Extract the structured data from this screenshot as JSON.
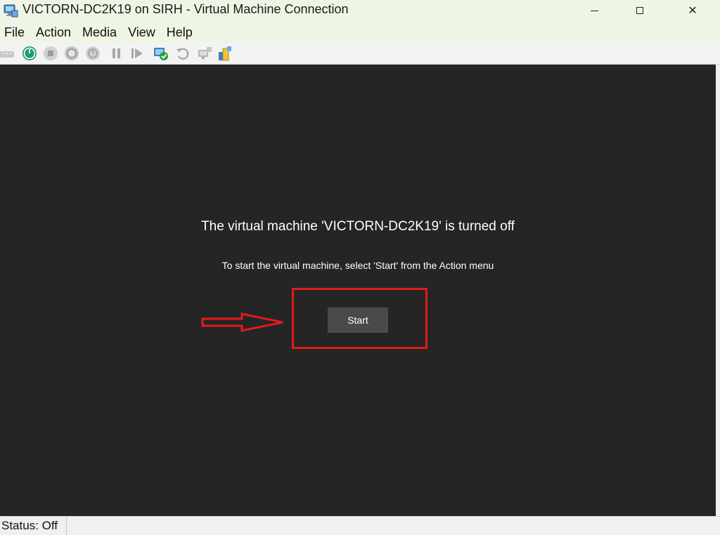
{
  "window": {
    "title": "VICTORN-DC2K19 on SIRH - Virtual Machine Connection",
    "app_icon": "hyper-v-vm-connection-icon",
    "controls": {
      "minimize_icon": "minimize-icon",
      "maximize_icon": "maximize-icon",
      "close_icon": "close-icon",
      "close_glyph": "✕"
    }
  },
  "menu": {
    "items": [
      "File",
      "Action",
      "Media",
      "View",
      "Help"
    ]
  },
  "toolbar": {
    "buttons": [
      {
        "icon": "ctrl-alt-del-icon",
        "enabled": false
      },
      {
        "icon": "start-icon",
        "enabled": true,
        "color": "#1f9d6f"
      },
      {
        "icon": "turn-off-icon",
        "enabled": false
      },
      {
        "icon": "shut-down-icon",
        "enabled": false
      },
      {
        "icon": "save-icon",
        "enabled": false
      },
      {
        "icon": "pause-icon",
        "enabled": false
      },
      {
        "icon": "resume-icon",
        "enabled": false
      },
      {
        "icon": "checkpoint-icon",
        "enabled": true
      },
      {
        "icon": "revert-icon",
        "enabled": false
      },
      {
        "icon": "enhanced-session-icon",
        "enabled": false
      },
      {
        "icon": "share-icon",
        "enabled": true
      }
    ]
  },
  "vm": {
    "heading": "The virtual machine 'VICTORN-DC2K19' is turned off",
    "instruction": "To start the virtual machine, select 'Start' from the Action menu",
    "start_button_label": "Start",
    "background_color": "#252526",
    "highlight_color": "#e21b1b"
  },
  "status": {
    "text": "Status: Off"
  }
}
